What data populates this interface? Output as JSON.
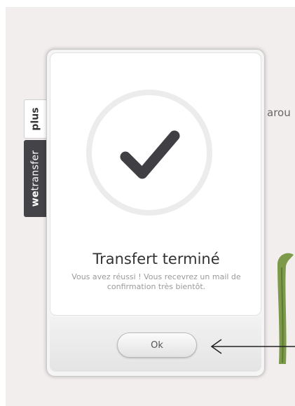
{
  "background": {
    "text": "arou"
  },
  "side_tabs": {
    "plus_label": "plus",
    "wetransfer_bold": "we",
    "wetransfer_rest": "transfer"
  },
  "dialog": {
    "icon": "checkmark-icon",
    "title": "Transfert terminé",
    "message": "Vous avez réussi ! Vous recevrez un mail de confirmation très bientôt.",
    "ok_label": "Ok"
  },
  "colors": {
    "checkmark": "#3f3f44",
    "tab_dark": "#444448",
    "arrow": "#222222",
    "plant": "#7c9a4a"
  }
}
